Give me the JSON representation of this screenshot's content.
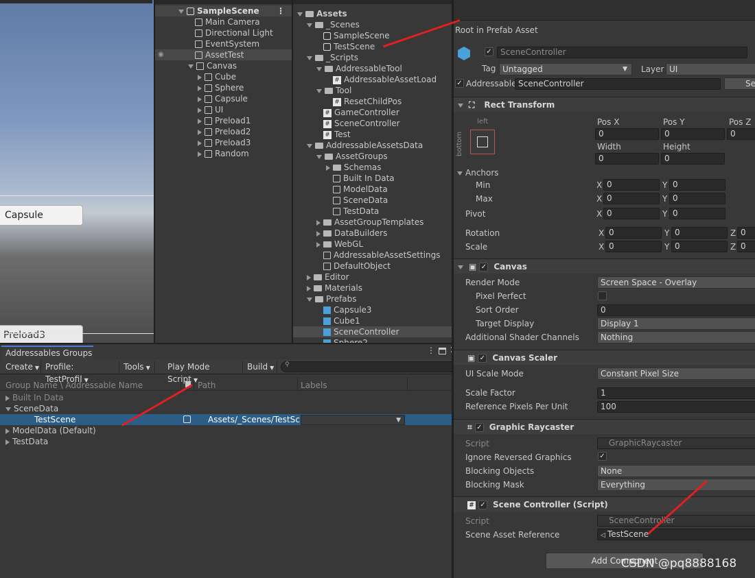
{
  "scene_view": {
    "btn_capsule": "Capsule",
    "btn_preload3": "Preload3"
  },
  "hierarchy": {
    "scene": "SampleScene",
    "items": [
      "Main Camera",
      "Directional Light",
      "EventSystem",
      "AssetTest",
      "Canvas",
      "Cube",
      "Sphere",
      "Capsule",
      "UI",
      "Preload1",
      "Preload2",
      "Preload3",
      "Random"
    ]
  },
  "project": {
    "items": [
      "Assets",
      "_Scenes",
      "SampleScene",
      "TestScene",
      "_Scripts",
      "AddressableTool",
      "AddressableAssetLoad",
      "Tool",
      "ResetChildPos",
      "GameController",
      "SceneController",
      "Test",
      "AddressableAssetsData",
      "AssetGroups",
      "Schemas",
      "Built In Data",
      "ModelData",
      "SceneData",
      "TestData",
      "AssetGroupTemplates",
      "DataBuilders",
      "WebGL",
      "AddressableAssetSettings",
      "DefaultObject",
      "Editor",
      "Materials",
      "Prefabs",
      "Capsule3",
      "Cube1",
      "SceneController",
      "Sphere2"
    ]
  },
  "addr": {
    "title": "Addressables Groups",
    "toolbar": [
      "Create",
      "Profile: TestProfil",
      "Tools",
      "Play Mode Script",
      "Build"
    ],
    "col_name": "Group Name \\ Addressable Name",
    "col_path": "Path",
    "col_labels": "Labels",
    "rows": [
      "Built In Data",
      "SceneData",
      "TestScene",
      "ModelData (Default)",
      "TestData"
    ],
    "path_value": "Assets/_Scenes/TestSc"
  },
  "inspector": {
    "prefab_title": "Root in Prefab Asset",
    "name": "SceneController",
    "tag_label": "Tag",
    "tag_value": "Untagged",
    "layer_label": "Layer",
    "layer_value": "UI",
    "addressable_label": "Addressable",
    "addressable_value": "SceneController",
    "select_btn": "Se",
    "rect": {
      "title": "Rect Transform",
      "left": "left",
      "bottom": "bottom",
      "posx": "Pos X",
      "posy": "Pos Y",
      "posz": "Pos Z",
      "width": "Width",
      "height": "Height",
      "anchors": "Anchors",
      "min": "Min",
      "max": "Max",
      "pivot": "Pivot",
      "rotation": "Rotation",
      "scale": "Scale",
      "zero": "0",
      "x": "X",
      "y": "Y",
      "z": "Z"
    },
    "canvas": {
      "title": "Canvas",
      "render_mode": "Render Mode",
      "render_mode_value": "Screen Space - Overlay",
      "pixel_perfect": "Pixel Perfect",
      "sort_order": "Sort Order",
      "sort_order_value": "0",
      "target_display": "Target Display",
      "target_display_value": "Display 1",
      "shader_channels": "Additional Shader Channels",
      "shader_channels_value": "Nothing"
    },
    "scaler": {
      "title": "Canvas Scaler",
      "ui_scale_mode": "UI Scale Mode",
      "ui_scale_mode_value": "Constant Pixel Size",
      "scale_factor": "Scale Factor",
      "scale_factor_value": "1",
      "ref_ppu": "Reference Pixels Per Unit",
      "ref_ppu_value": "100"
    },
    "raycaster": {
      "title": "Graphic Raycaster",
      "script": "Script",
      "script_value": "GraphicRaycaster",
      "ignore_reversed": "Ignore Reversed Graphics",
      "blocking_objects": "Blocking Objects",
      "blocking_objects_value": "None",
      "blocking_mask": "Blocking Mask",
      "blocking_mask_value": "Everything"
    },
    "scenectrl": {
      "title": "Scene Controller (Script)",
      "script": "Script",
      "script_value": "SceneController",
      "scene_ref": "Scene Asset Reference",
      "scene_ref_value": "TestScene"
    },
    "add_component": "Add Component"
  },
  "watermark": "CSDN @pq8888168"
}
